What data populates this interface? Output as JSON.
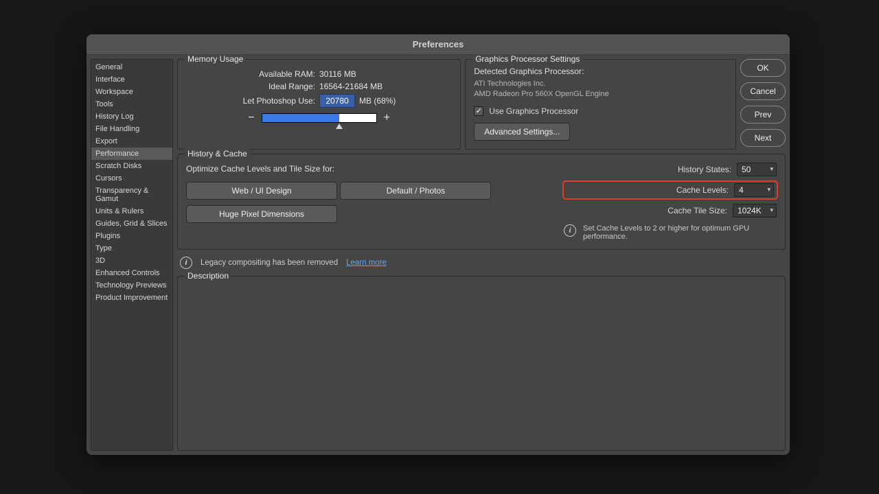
{
  "window": {
    "title": "Preferences"
  },
  "sidebar": {
    "items": [
      "General",
      "Interface",
      "Workspace",
      "Tools",
      "History Log",
      "File Handling",
      "Export",
      "Performance",
      "Scratch Disks",
      "Cursors",
      "Transparency & Gamut",
      "Units & Rulers",
      "Guides, Grid & Slices",
      "Plugins",
      "Type",
      "3D",
      "Enhanced Controls",
      "Technology Previews",
      "Product Improvement"
    ],
    "selected_index": 7
  },
  "actions": {
    "ok": "OK",
    "cancel": "Cancel",
    "prev": "Prev",
    "next": "Next"
  },
  "memory": {
    "title": "Memory Usage",
    "available_label": "Available RAM:",
    "available_value": "30116 MB",
    "ideal_label": "Ideal Range:",
    "ideal_value": "16564-21684 MB",
    "use_label": "Let Photoshop Use:",
    "use_value": "20780",
    "use_suffix": "MB (68%)",
    "slider_percent": 68
  },
  "gpu": {
    "title": "Graphics Processor Settings",
    "detected_label": "Detected Graphics Processor:",
    "vendor": "ATI Technologies Inc.",
    "device": "AMD Radeon Pro 560X OpenGL Engine",
    "use_gpu_label": "Use Graphics Processor",
    "use_gpu_checked": true,
    "advanced": "Advanced Settings..."
  },
  "history_cache": {
    "title": "History & Cache",
    "optimize_label": "Optimize Cache Levels and Tile Size for:",
    "presets": [
      "Web / UI Design",
      "Default / Photos",
      "Huge Pixel Dimensions"
    ],
    "history_states_label": "History States:",
    "history_states_value": "50",
    "cache_levels_label": "Cache Levels:",
    "cache_levels_value": "4",
    "cache_tile_label": "Cache Tile Size:",
    "cache_tile_value": "1024K",
    "info": "Set Cache Levels to 2 or higher for optimum GPU performance."
  },
  "legacy": {
    "text": "Legacy compositing has been removed",
    "link": "Learn more"
  },
  "description": {
    "title": "Description"
  }
}
